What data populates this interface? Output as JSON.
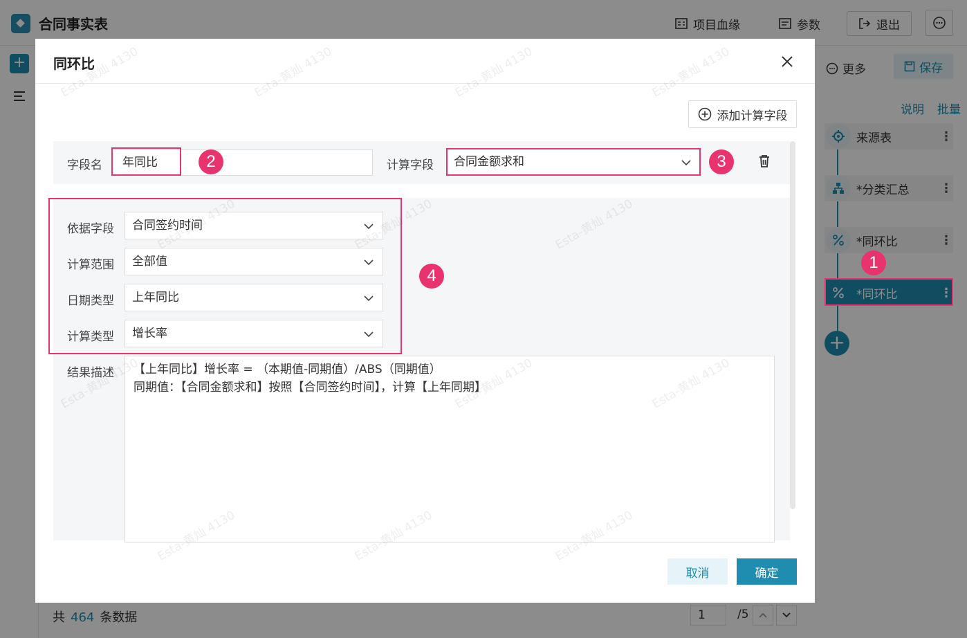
{
  "app": {
    "title": "合同事实表",
    "lineage_label": "项目血缘",
    "params_label": "参数",
    "exit_label": "退出"
  },
  "footer": {
    "total_prefix": "共",
    "total_count": "464",
    "total_suffix": "条数据",
    "page_current": "1",
    "page_total": "/5"
  },
  "right_panel": {
    "more_label": "更多",
    "save_label": "保存",
    "explain_link": "说明",
    "batch_link": "批量",
    "nodes": [
      {
        "label": "来源表",
        "icon": "target-icon"
      },
      {
        "label": "*分类汇总",
        "icon": "hierarchy-icon"
      },
      {
        "label": "*同环比",
        "icon": "percent-icon"
      },
      {
        "label": "*同环比",
        "icon": "percent-icon",
        "active": true
      }
    ]
  },
  "dialog": {
    "title": "同环比",
    "add_calc_field_label": "添加计算字段",
    "field_name_label": "字段名",
    "field_name_value": "年同比",
    "calc_field_label": "计算字段",
    "calc_field_value": "合同金额求和",
    "basis_field_label": "依据字段",
    "basis_field_value": "合同签约时间",
    "calc_range_label": "计算范围",
    "calc_range_value": "全部值",
    "date_type_label": "日期类型",
    "date_type_value": "上年同比",
    "calc_type_label": "计算类型",
    "calc_type_value": "增长率",
    "result_desc_label": "结果描述",
    "result_desc_line1": "【上年同比】增长率 = （本期值-同期值）/ABS（同期值）",
    "result_desc_line2": "同期值：【合同金额求和】按照【合同签约时间】，计算【上年同期】",
    "cancel_label": "取消",
    "ok_label": "确定"
  },
  "annotations": {
    "badge_1": "1",
    "badge_2": "2",
    "badge_3": "3",
    "badge_4": "4",
    "highlight_color": "#e8336f"
  },
  "watermark_text": "Esta-黄灿 4130",
  "colors": {
    "accent": "#1f8db0",
    "overlay": "rgba(0,0,0,0.45)"
  }
}
